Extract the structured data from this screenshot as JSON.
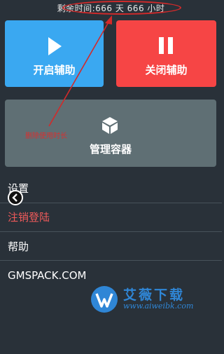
{
  "status": {
    "remaining_time": "剩余时间:666 天 666 小时"
  },
  "tiles": {
    "start_label": "开启辅助",
    "stop_label": "关闭辅助",
    "manage_label": "管理容器"
  },
  "annotation": {
    "text": "删除使用时长"
  },
  "menu": {
    "settings": "设置",
    "logout": "注销登陆",
    "help": "帮助",
    "website": "GMSPACK.COM"
  },
  "watermark": {
    "name": "艾薇下载",
    "url": "www.aiweibk.com"
  },
  "colors": {
    "background": "#293139",
    "start": "#3aa8f1",
    "stop": "#f64545",
    "manage": "#5f6f74",
    "logout_text": "#f15a5a",
    "annotation": "#d83030"
  },
  "icons": {
    "start": "play-icon",
    "stop": "pause-icon",
    "manage": "cube-icon",
    "back": "back-arrow-icon",
    "watermark": "aiwei-logo-icon"
  }
}
